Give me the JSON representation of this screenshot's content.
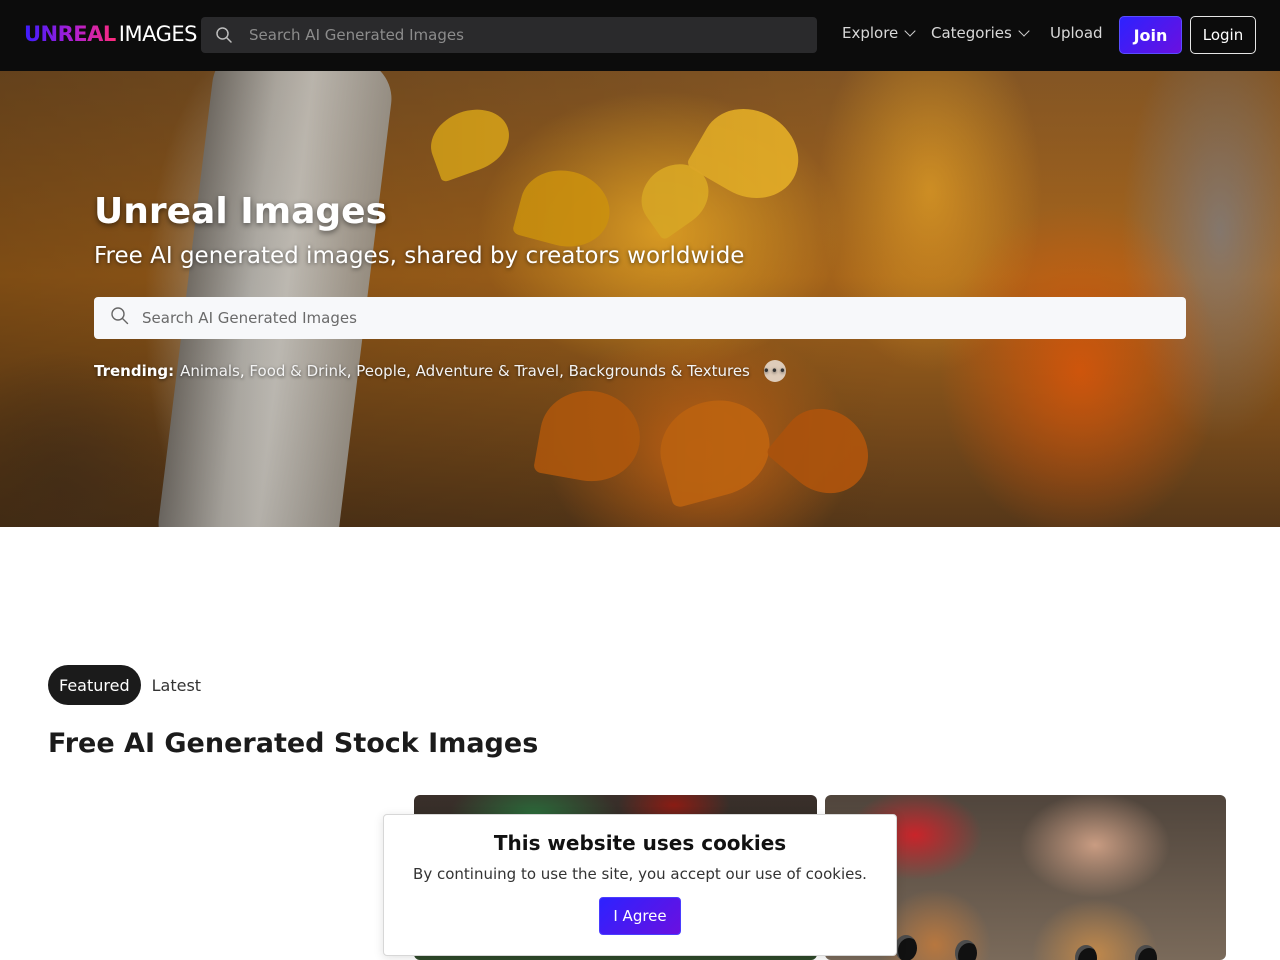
{
  "header": {
    "logo_strong": "UNREAL",
    "logo_light": "IMAGES",
    "search_placeholder": "Search AI Generated Images",
    "nav": {
      "explore": "Explore",
      "categories": "Categories",
      "upload": "Upload"
    },
    "join": "Join",
    "login": "Login"
  },
  "hero": {
    "title": "Unreal Images",
    "subtitle": "Free AI generated images, shared by creators worldwide",
    "search_placeholder": "Search AI Generated Images",
    "trending_label": "Trending:",
    "trending": [
      "Animals",
      "Food & Drink",
      "People",
      "Adventure & Travel",
      "Backgrounds & Textures"
    ],
    "more": "•••"
  },
  "content": {
    "tabs": {
      "featured": "Featured",
      "latest": "Latest"
    },
    "section_title": "Free AI Generated Stock Images"
  },
  "cookie": {
    "title": "This website uses cookies",
    "text": "By continuing to use the site, you accept our use of cookies.",
    "agree": "I Agree"
  },
  "colors": {
    "accent": "#2d22ff",
    "nav_bg": "#0c0c0c"
  }
}
